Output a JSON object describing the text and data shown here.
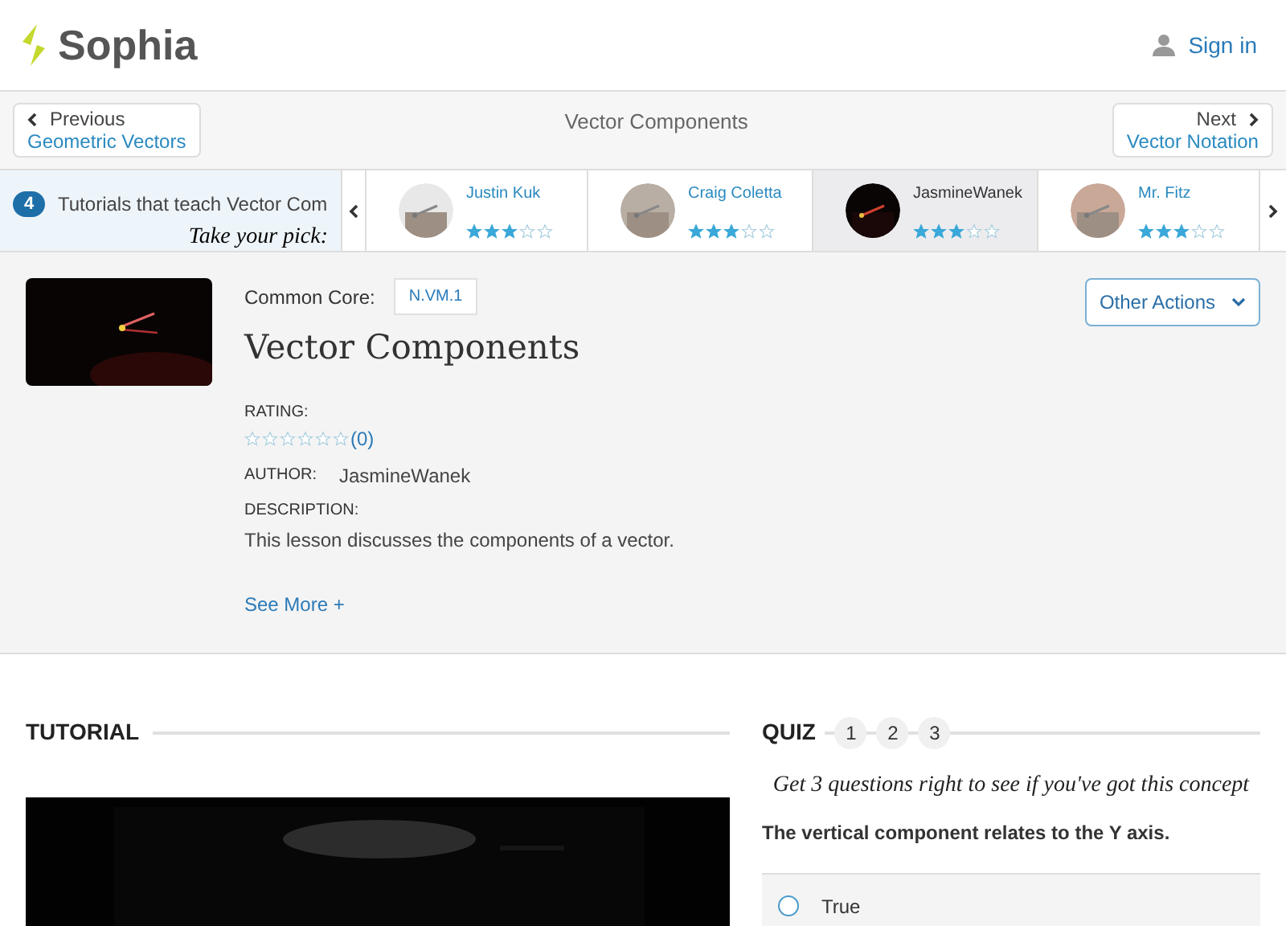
{
  "header": {
    "logo": "Sophia",
    "sign_in": "Sign in"
  },
  "nav": {
    "previous_label": "Previous",
    "previous_title": "Geometric Vectors",
    "current": "Vector Components",
    "next_label": "Next",
    "next_title": "Vector Notation"
  },
  "carousel": {
    "count": "4",
    "heading": "Tutorials that teach Vector Com",
    "pick": "Take your pick:",
    "tutors": [
      {
        "name": "Justin Kuk",
        "stars": 3,
        "selected": false
      },
      {
        "name": "Craig Coletta",
        "stars": 3,
        "selected": false
      },
      {
        "name": "JasmineWanek",
        "stars": 3,
        "selected": true
      },
      {
        "name": "Mr. Fitz",
        "stars": 3,
        "selected": false
      }
    ]
  },
  "details": {
    "common_core_label": "Common Core:",
    "standard": "N.VM.1",
    "title": "Vector Components",
    "other_actions": "Other Actions",
    "rating_label": "RATING:",
    "stars": 0,
    "rating_count": "(0)",
    "author_label": "AUTHOR:",
    "author": "JasmineWanek",
    "description_label": "DESCRIPTION:",
    "description": "This lesson discusses the components of a vector.",
    "see_more": "See More +"
  },
  "tutorial": {
    "heading": "TUTORIAL"
  },
  "quiz": {
    "heading": "QUIZ",
    "steps": [
      "1",
      "2",
      "3"
    ],
    "prompt": "Get 3 questions right to see if you've got this concept",
    "question": "The vertical component relates to the Y axis.",
    "options": [
      {
        "label": "True",
        "selected": false
      }
    ]
  }
}
